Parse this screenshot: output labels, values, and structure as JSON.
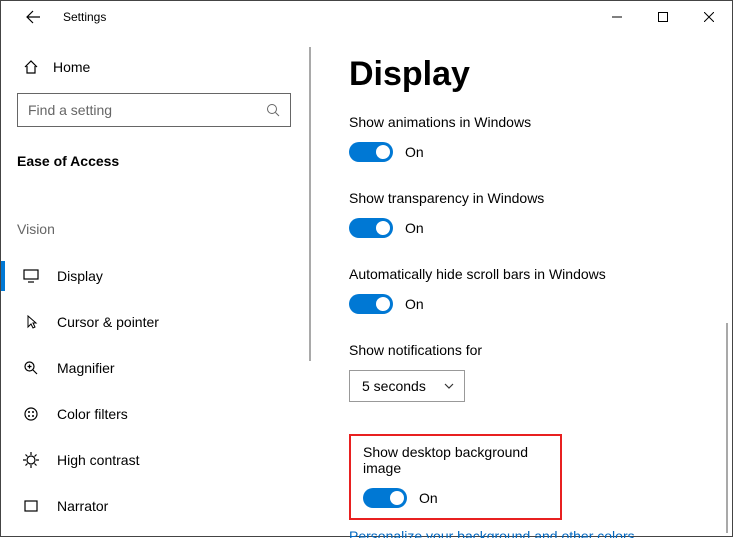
{
  "titlebar": {
    "app_title": "Settings"
  },
  "sidebar": {
    "home_label": "Home",
    "search_placeholder": "Find a setting",
    "group_header": "Ease of Access",
    "group_label": "Vision",
    "items": [
      {
        "label": "Display"
      },
      {
        "label": "Cursor & pointer"
      },
      {
        "label": "Magnifier"
      },
      {
        "label": "Color filters"
      },
      {
        "label": "High contrast"
      },
      {
        "label": "Narrator"
      }
    ]
  },
  "main": {
    "title": "Display",
    "settings": [
      {
        "label": "Show animations in Windows",
        "state": "On"
      },
      {
        "label": "Show transparency in Windows",
        "state": "On"
      },
      {
        "label": "Automatically hide scroll bars in Windows",
        "state": "On"
      }
    ],
    "notifications_label": "Show notifications for",
    "notifications_value": "5 seconds",
    "highlighted": {
      "label": "Show desktop background image",
      "state": "On"
    },
    "personalize_link": "Personalize your background and other colors"
  }
}
